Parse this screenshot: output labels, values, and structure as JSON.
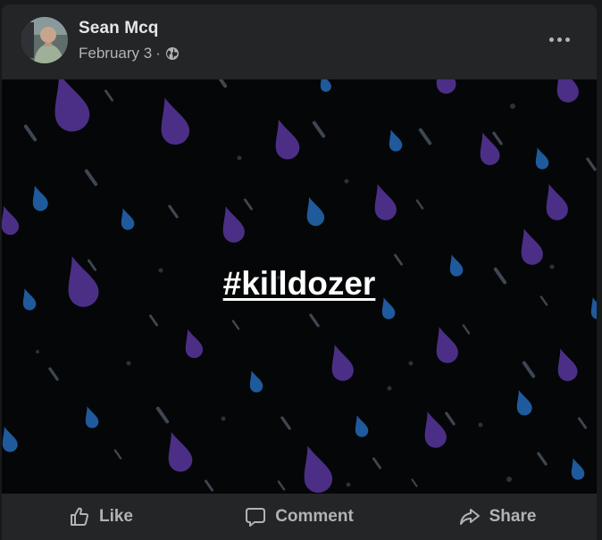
{
  "post": {
    "author": "Sean Mcq",
    "date": "February 3",
    "separator": "·",
    "privacy_icon": "globe-icon",
    "more_icon": "more-options-icon",
    "hashtag": "#killdozer",
    "background": "rain-drops-pattern",
    "colors": {
      "card": "#242526",
      "media_background": "#050607",
      "drop_purple": "#4b2f86",
      "drop_blue": "#1f5a9c",
      "drop_gray": "#3d4752",
      "text_primary": "#e4e6eb",
      "text_secondary": "#b0b3b8"
    }
  },
  "actions": {
    "like_label": "Like",
    "comment_label": "Comment",
    "share_label": "Share",
    "like_icon": "thumbs-up-icon",
    "comment_icon": "comment-bubble-icon",
    "share_icon": "share-arrow-icon"
  }
}
